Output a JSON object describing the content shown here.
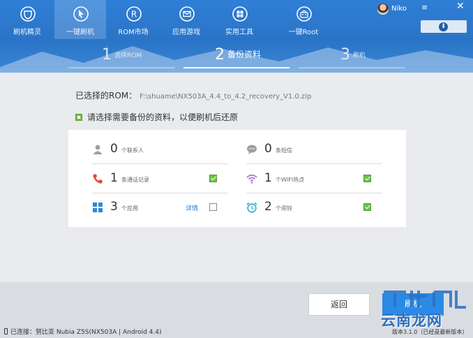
{
  "nav": {
    "items": [
      {
        "label": "刷机精灵",
        "icon": "shield-icon"
      },
      {
        "label": "一键刷机",
        "icon": "cursor-icon",
        "active": true
      },
      {
        "label": "ROM市场",
        "icon": "rom-icon"
      },
      {
        "label": "应用游戏",
        "icon": "mail-icon"
      },
      {
        "label": "实用工具",
        "icon": "grid-icon"
      },
      {
        "label": "一键Root",
        "icon": "robot-icon"
      }
    ]
  },
  "user": {
    "name": "Niko"
  },
  "window": {
    "menu": "≡",
    "close": "✕"
  },
  "steps": [
    {
      "num": "1",
      "label": "选择ROM"
    },
    {
      "num": "2",
      "label": "备份资料",
      "active": true
    },
    {
      "num": "3",
      "label": "刷机"
    }
  ],
  "rom": {
    "label": "已选择的ROM：",
    "path": "F:\\shuame\\NX503A_4.4_to_4.2_recovery_V1.0.zip"
  },
  "hint": "请选择需要备份的资料，以便刷机后还原",
  "backup_items": [
    {
      "icon": "contact-icon",
      "count": "0",
      "desc": "个联系人",
      "checked": null,
      "detail": ""
    },
    {
      "icon": "sms-icon",
      "count": "0",
      "desc": "条短信",
      "checked": null,
      "detail": ""
    },
    {
      "icon": "call-icon",
      "count": "1",
      "desc": "条通话记录",
      "checked": true,
      "detail": ""
    },
    {
      "icon": "wifi-icon",
      "count": "1",
      "desc": "个WIFI热点",
      "checked": true,
      "detail": ""
    },
    {
      "icon": "apps-icon",
      "count": "3",
      "desc": "个应用",
      "checked": false,
      "detail": "详情"
    },
    {
      "icon": "alarm-icon",
      "count": "2",
      "desc": "个闹铃",
      "checked": true,
      "detail": ""
    }
  ],
  "buttons": {
    "back": "返回",
    "flash": "刷机"
  },
  "status": {
    "connection": "已连接：努比亚 Nubia Z5S(NX503A | Android 4.4)",
    "version": "版本3.1.0（已经是最新版本）"
  },
  "watermark": "云南龙网",
  "colors": {
    "primary": "#2a74c7",
    "check": "#6cc24a",
    "link": "#2a7ad8"
  }
}
